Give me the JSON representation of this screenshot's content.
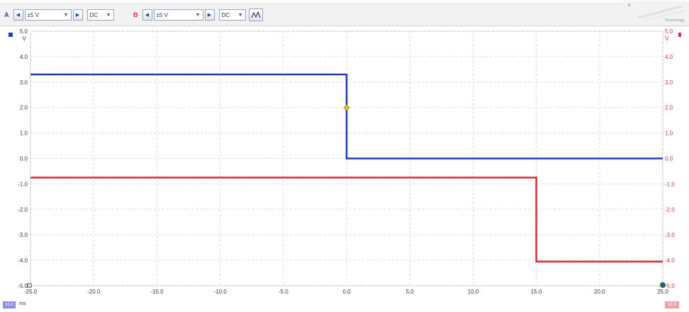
{
  "toolbar": {
    "channel_a": {
      "label": "A",
      "range": "±5 V",
      "coupling": "DC",
      "color": "#1f4fa8"
    },
    "channel_b": {
      "label": "B",
      "range": "±5 V",
      "coupling": "DC",
      "color": "#d0304a"
    },
    "trigger_icon": "waveform-trigger-icon",
    "logo_text": "Technology"
  },
  "axes": {
    "left_unit": "V",
    "right_unit": "V",
    "x_unit": "ms",
    "left_zoom": "x1.0",
    "right_zoom": "x1.0"
  },
  "chart_data": {
    "type": "line",
    "title": "",
    "xlabel": "ms",
    "ylabel": "V",
    "xlim": [
      -25.0,
      25.0
    ],
    "ylim": [
      -5.0,
      5.0
    ],
    "x_ticks": [
      "-25.0",
      "-20.0",
      "-15.0",
      "-10.0",
      "-5.0",
      "0.0",
      "5.0",
      "10.0",
      "15.0",
      "20.0",
      "25.0"
    ],
    "y_ticks_left": [
      "5.0",
      "4.0",
      "3.0",
      "2.0",
      "1.0",
      "0.0",
      "-1.0",
      "-2.0",
      "-3.0",
      "-4.0",
      "-5.0"
    ],
    "y_ticks_right": [
      "5.0",
      "4.0",
      "3.0",
      "2.0",
      "1.0",
      "0.0",
      "-1.0",
      "-2.0",
      "-3.0",
      "-4.0",
      "-5.0"
    ],
    "y_tick_values": [
      5,
      4,
      3,
      2,
      1,
      0,
      -1,
      -2,
      -3,
      -4,
      -5
    ],
    "x_tick_values": [
      -25,
      -20,
      -15,
      -10,
      -5,
      0,
      5,
      10,
      15,
      20,
      25
    ],
    "grid": true,
    "series": [
      {
        "name": "A",
        "color": "#1f3fb0",
        "x": [
          -25.0,
          0.0,
          0.0,
          25.0
        ],
        "y": [
          3.3,
          3.3,
          0.0,
          0.0
        ]
      },
      {
        "name": "B",
        "color": "#e03040",
        "x": [
          -25.0,
          15.0,
          15.0,
          25.0
        ],
        "y": [
          -0.75,
          -0.75,
          -4.05,
          -4.05
        ]
      }
    ],
    "trigger": {
      "x": 0.0,
      "y": 2.0,
      "color": "#e8c020"
    }
  }
}
